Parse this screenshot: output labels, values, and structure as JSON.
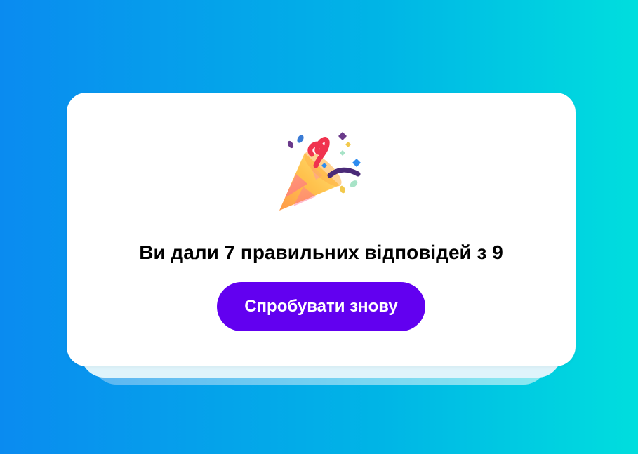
{
  "result": {
    "icon": "party-popper-icon",
    "text": "Ви дали 7 правильних відповідей з 9",
    "correct_answers": 7,
    "total_questions": 9
  },
  "actions": {
    "retry_label": "Спробувати знову"
  },
  "colors": {
    "background_gradient": [
      "#0a8bf0",
      "#00b5e6",
      "#00dede"
    ],
    "card": "#ffffff",
    "button": "#6200f0",
    "button_text": "#ffffff"
  }
}
